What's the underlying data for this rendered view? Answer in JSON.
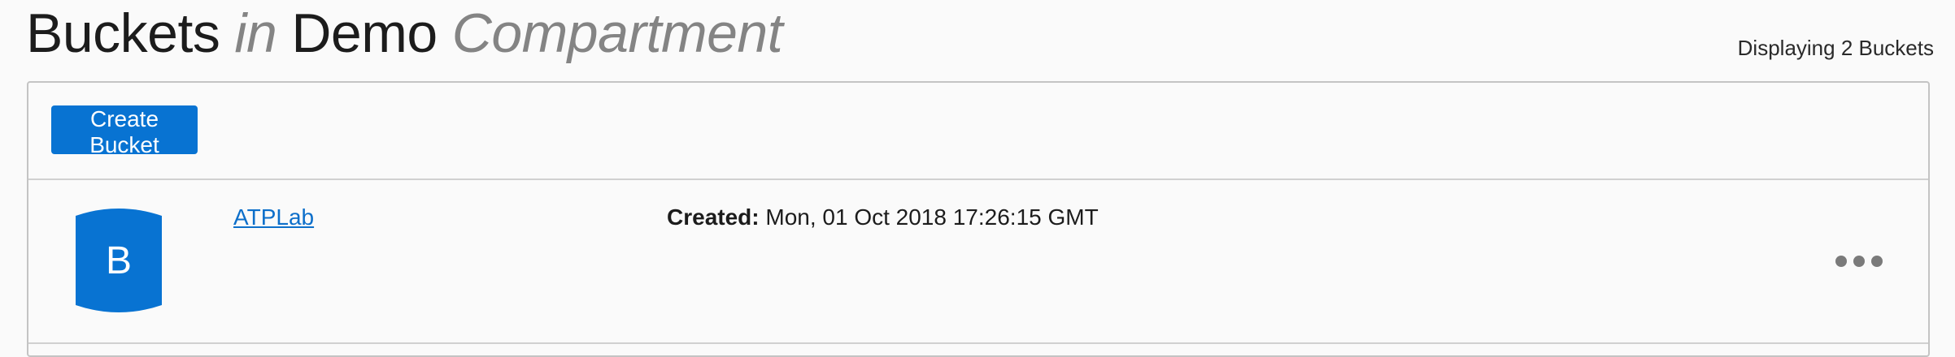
{
  "header": {
    "word1": "Buckets",
    "word2": "in",
    "word3": "Demo",
    "word4": "Compartment"
  },
  "summary": {
    "count_text": "Displaying 2 Buckets"
  },
  "toolbar": {
    "create_label": "Create Bucket"
  },
  "buckets": [
    {
      "icon_letter": "B",
      "name": "ATPLab",
      "created_label": "Created:",
      "created_value": "Mon, 01 Oct 2018 17:26:15 GMT"
    }
  ],
  "colors": {
    "accent": "#0873d2",
    "link": "#0d6fca",
    "muted": "#848484"
  },
  "icons": {
    "bucket": "bucket-icon",
    "actions": "more-actions-icon"
  }
}
